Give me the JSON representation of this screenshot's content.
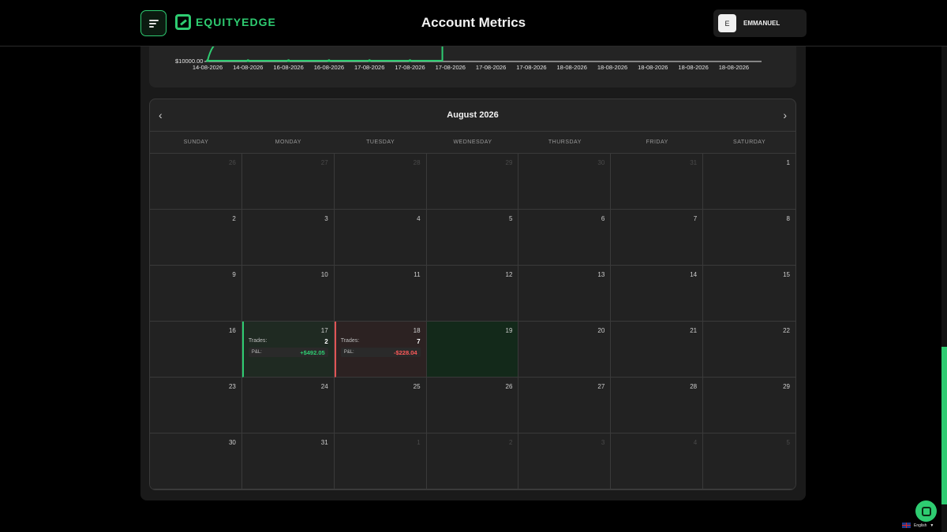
{
  "header": {
    "brand": "EQUITYEDGE",
    "title": "Account Metrics",
    "user": {
      "initial": "E",
      "name": "EMMANUEL"
    }
  },
  "chart_data": {
    "type": "line",
    "y_min_label": "$10000.00",
    "x_labels": [
      "14-08-2026",
      "14-08-2026",
      "16-08-2026",
      "16-08-2026",
      "17-08-2026",
      "17-08-2026",
      "17-08-2026",
      "17-08-2026",
      "17-08-2026",
      "18-08-2026",
      "18-08-2026",
      "18-08-2026",
      "18-08-2026",
      "18-08-2026"
    ],
    "color": "#2ecc71"
  },
  "calendar": {
    "month_label": "August 2026",
    "prev_icon": "‹",
    "next_icon": "›",
    "weekdays": [
      "SUNDAY",
      "MONDAY",
      "TUESDAY",
      "WEDNESDAY",
      "THURSDAY",
      "FRIDAY",
      "SATURDAY"
    ],
    "trades_label": "Trades:",
    "pnl_label": "P&L:",
    "days": [
      {
        "n": "26",
        "muted": true
      },
      {
        "n": "27",
        "muted": true
      },
      {
        "n": "28",
        "muted": true
      },
      {
        "n": "29",
        "muted": true
      },
      {
        "n": "30",
        "muted": true
      },
      {
        "n": "31",
        "muted": true
      },
      {
        "n": "1"
      },
      {
        "n": "2"
      },
      {
        "n": "3"
      },
      {
        "n": "4"
      },
      {
        "n": "5"
      },
      {
        "n": "6"
      },
      {
        "n": "7"
      },
      {
        "n": "8"
      },
      {
        "n": "9"
      },
      {
        "n": "10"
      },
      {
        "n": "11"
      },
      {
        "n": "12"
      },
      {
        "n": "13"
      },
      {
        "n": "14"
      },
      {
        "n": "15"
      },
      {
        "n": "16"
      },
      {
        "n": "17",
        "state": "win",
        "trades": "2",
        "pnl": "+$492.05"
      },
      {
        "n": "18",
        "state": "loss",
        "trades": "7",
        "pnl": "-$228.04"
      },
      {
        "n": "19",
        "state": "today"
      },
      {
        "n": "20"
      },
      {
        "n": "21"
      },
      {
        "n": "22"
      },
      {
        "n": "23"
      },
      {
        "n": "24"
      },
      {
        "n": "25"
      },
      {
        "n": "26"
      },
      {
        "n": "27"
      },
      {
        "n": "28"
      },
      {
        "n": "29"
      },
      {
        "n": "30"
      },
      {
        "n": "31"
      },
      {
        "n": "1",
        "muted": true
      },
      {
        "n": "2",
        "muted": true
      },
      {
        "n": "3",
        "muted": true
      },
      {
        "n": "4",
        "muted": true
      },
      {
        "n": "5",
        "muted": true
      }
    ]
  },
  "footer": {
    "language": "English",
    "chevron_icon": "▼"
  },
  "colors": {
    "accent": "#2ecc71",
    "loss": "#ff5a5a"
  }
}
